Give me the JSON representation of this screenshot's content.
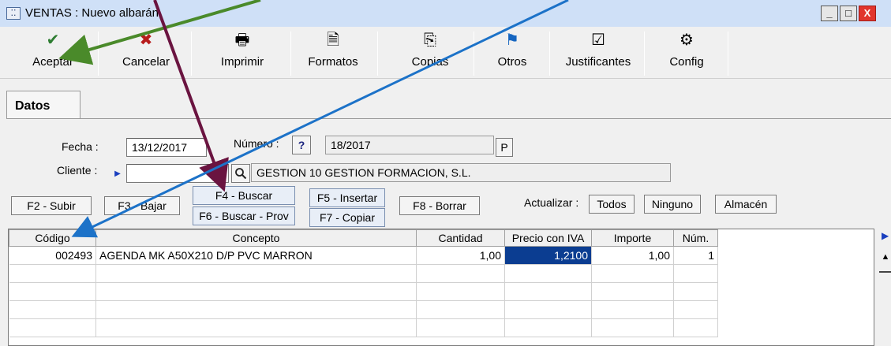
{
  "window": {
    "icon": "window-icon",
    "title": "VENTAS : Nuevo albarán",
    "controls": [
      "_",
      "□",
      "X"
    ]
  },
  "toolbar": [
    {
      "label": "Aceptar",
      "icon": "✔",
      "icon_name": "checkmark-icon",
      "color": "#2e7d32"
    },
    {
      "label": "Cancelar",
      "icon": "✖",
      "icon_name": "cancel-x-icon",
      "color": "#b71c1c"
    },
    {
      "label": "Imprimir",
      "icon": "🖶",
      "icon_name": "printer-icon",
      "color": "#333333"
    },
    {
      "label": "Formatos",
      "icon": "🗎",
      "icon_name": "document-format-icon",
      "color": "#333333"
    },
    {
      "label": "Copias",
      "icon": "⎘",
      "icon_name": "copies-icon",
      "color": "#333333"
    },
    {
      "label": "Otros",
      "icon": "⚑",
      "icon_name": "others-icon",
      "color": "#1565c0"
    },
    {
      "label": "Justificantes",
      "icon": "☑",
      "icon_name": "receipt-icon",
      "color": "#333333"
    },
    {
      "label": "Config",
      "icon": "⚙",
      "icon_name": "gear-icon",
      "color": "#333333"
    }
  ],
  "tab": {
    "label": "Datos"
  },
  "form": {
    "fecha_label": "Fecha :",
    "fecha_value": "13/12/2017",
    "numero_label": "Número :",
    "numero_help": "?",
    "numero_value": "18/2017",
    "p_button": "P",
    "cliente_label": "Cliente :",
    "cliente_value": "",
    "cliente_name": "GESTION 10 GESTION FORMACION, S.L."
  },
  "actions": {
    "f2": "F2 - Subir",
    "f3": "F3 - Bajar",
    "f4": "F4 - Buscar",
    "f6": "F6 - Buscar - Prov",
    "f5": "F5 - Insertar",
    "f7": "F7 - Copiar",
    "f8": "F8 - Borrar",
    "actualizar_label": "Actualizar :",
    "todos": "Todos",
    "ninguno": "Ninguno",
    "almacen": "Almacén"
  },
  "grid": {
    "columns": [
      "Código",
      "Concepto",
      "Cantidad",
      "Precio con IVA",
      "Importe",
      "Núm."
    ],
    "rows": [
      [
        "002493",
        "AGENDA MK A50X210 D/P PVC MARRON",
        "1,00",
        "1,2100",
        "1,00",
        "1"
      ]
    ]
  },
  "annotation_colors": {
    "green": "#4a8a2a",
    "maroon": "#6a1440",
    "blue": "#1c72c8"
  }
}
